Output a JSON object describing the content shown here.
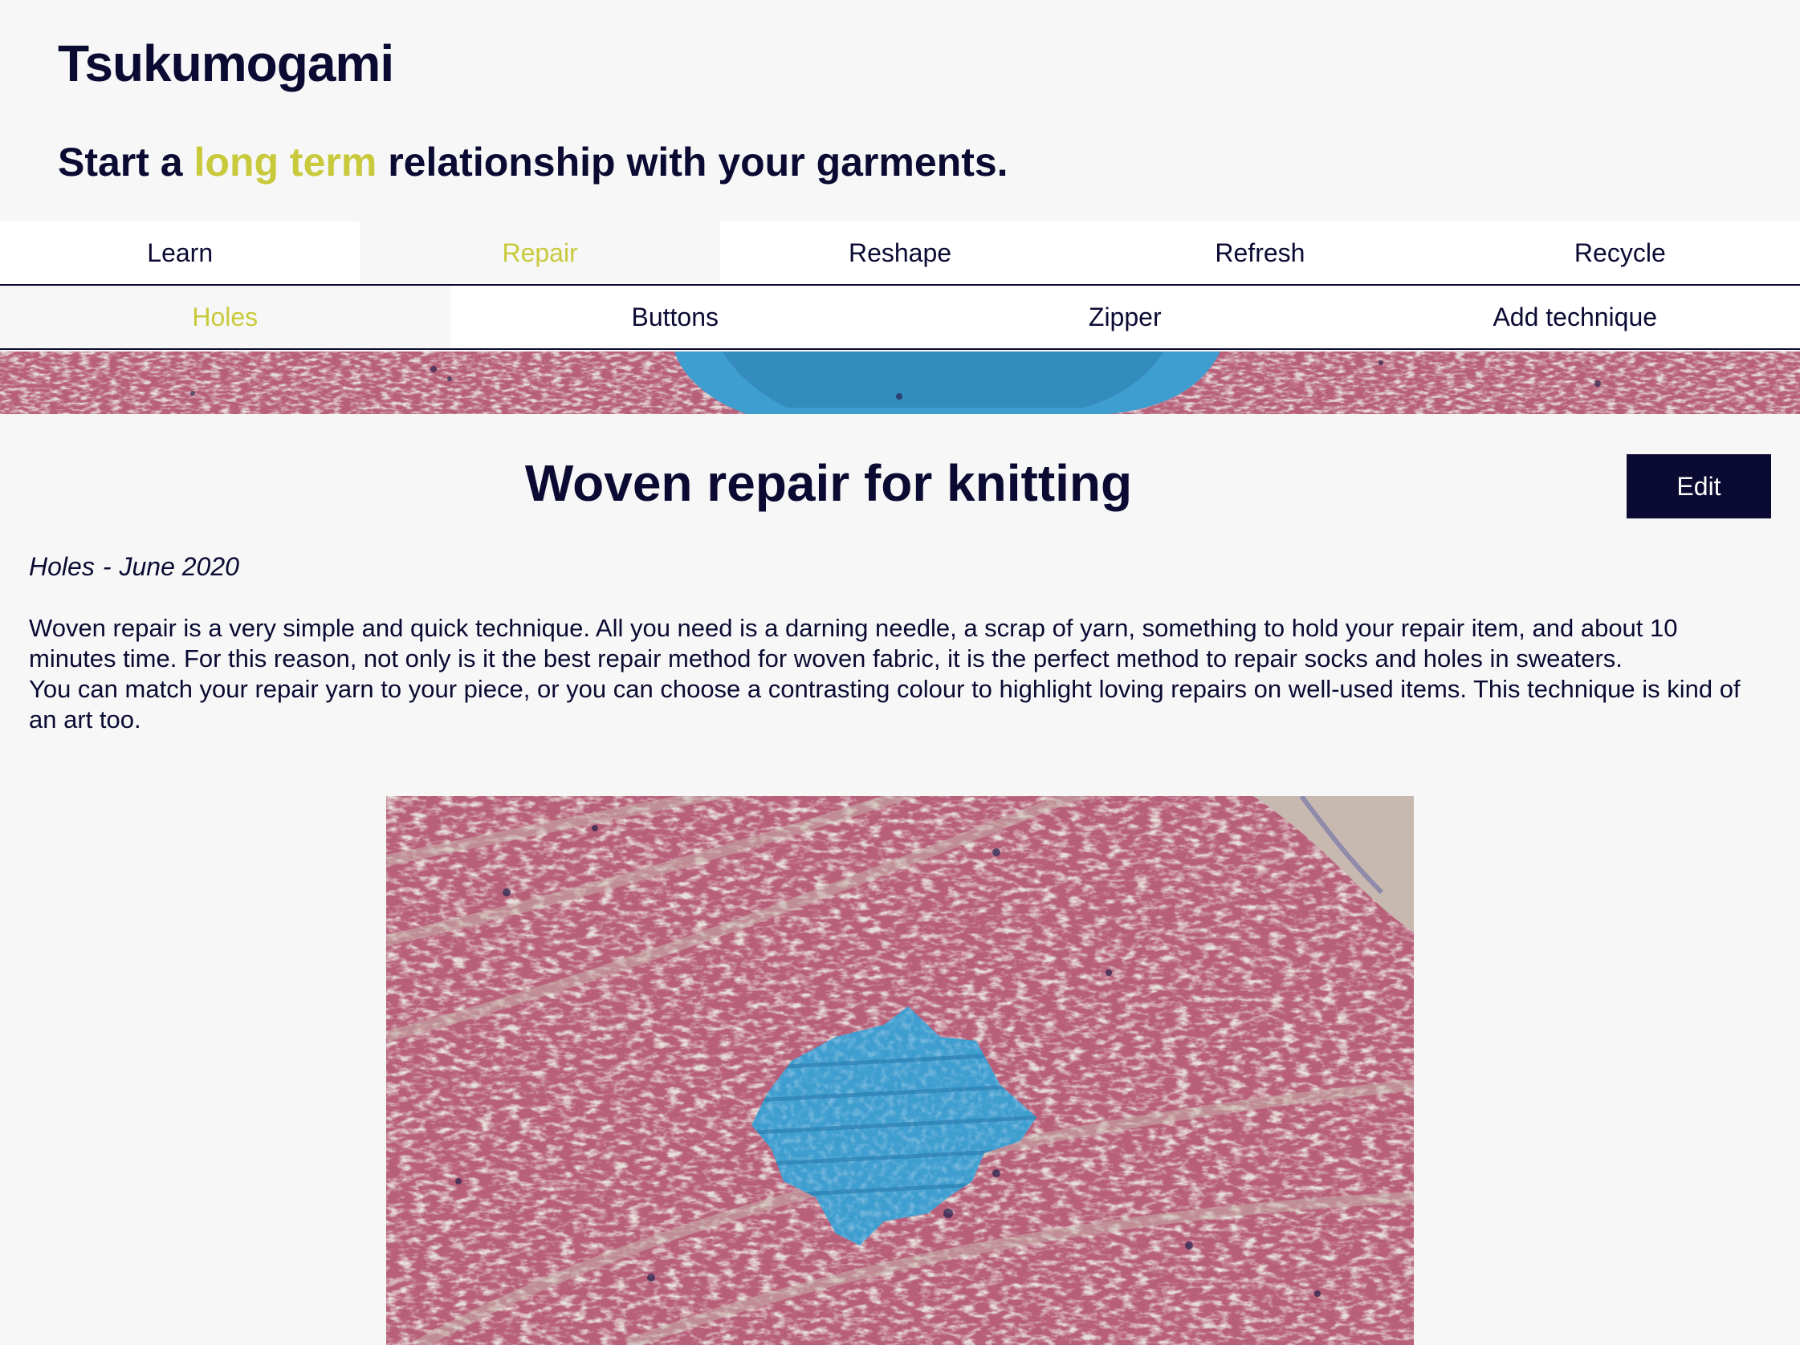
{
  "site": {
    "title": "Tsukumogami",
    "tagline_before": "Start a ",
    "tagline_accent": "long term",
    "tagline_after": " relationship with your garments."
  },
  "nav_primary": [
    {
      "label": "Learn",
      "active": false
    },
    {
      "label": "Repair",
      "active": true
    },
    {
      "label": "Reshape",
      "active": false
    },
    {
      "label": "Refresh",
      "active": false
    },
    {
      "label": "Recycle",
      "active": false
    }
  ],
  "nav_secondary": [
    {
      "label": "Holes",
      "active": true
    },
    {
      "label": "Buttons",
      "active": false
    },
    {
      "label": "Zipper",
      "active": false
    },
    {
      "label": "Add technique",
      "active": false
    }
  ],
  "article": {
    "title": "Woven repair for knitting",
    "edit_label": "Edit",
    "category": "Holes",
    "separator": "-",
    "date": "June 2020",
    "paragraphs": [
      "Woven repair is a very simple and quick technique. All you need is a darning needle, a scrap of yarn, something to hold your repair item, and about 10 minutes time. For this reason, not only is it the best repair method for woven fabric, it is the perfect method to repair socks and holes in sweaters.",
      "You can match your repair yarn to your piece, or you can choose a contrasting colour to highlight loving repairs on well-used items. This technique is kind of an art too."
    ]
  },
  "colors": {
    "navy": "#0b0a33",
    "accent": "#c9c93c",
    "page_bg": "#f6f7f6",
    "knit_pink": "#b85f7a",
    "knit_beige": "#c8b9b0",
    "patch_blue": "#3f9ed0"
  }
}
